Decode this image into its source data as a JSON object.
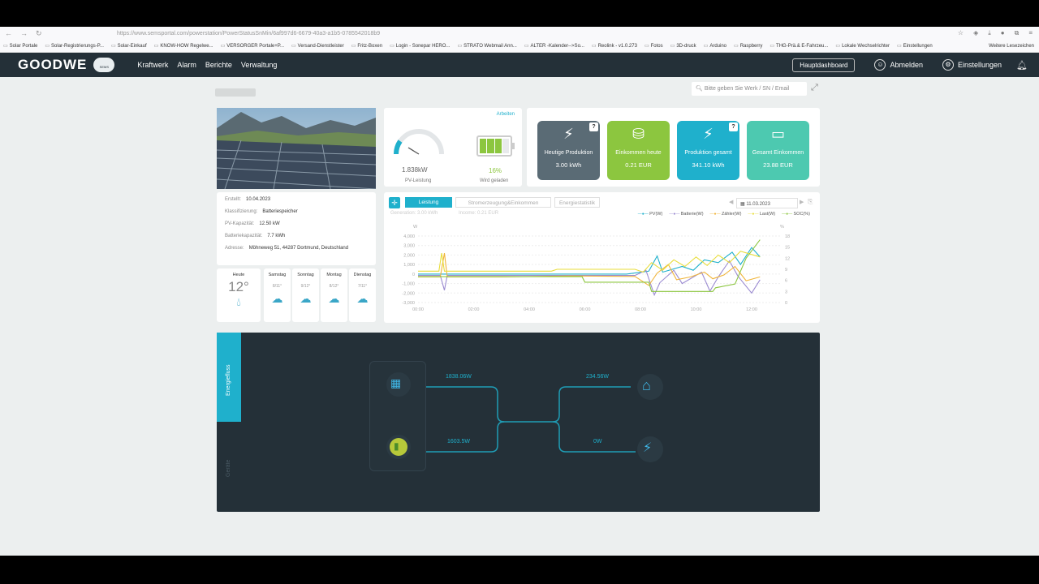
{
  "browser": {
    "url": "https://www.semsportal.com/powerstation/PowerStatusSnMin/6af997d6-6679-40a3-a1b5-0785542018b9",
    "bookmarks": [
      "Solar Portale",
      "Solar-Registrierungs-P...",
      "Solar-Einkauf",
      "KNOW-HOW Regelwe...",
      "VERSORGER Portale+P...",
      "Versand-Dienstleister",
      "Fritz-Boxen",
      "Login - Sonepar HERO...",
      "STRATO Webmail Ann...",
      "ALTER -Kalender-->So...",
      "Reolink - v1.0.273",
      "Fotos",
      "3D-druck",
      "Arduino",
      "Raspberry",
      "THG-Prä.& E-Fahrzeu...",
      "Lokale Wechselrichter",
      "Einstellungen"
    ],
    "more_bookmarks": "Weitere Lesezeichen"
  },
  "header": {
    "logo": "GOODWE",
    "logo_badge": "SEMS",
    "menu": [
      "Kraftwerk",
      "Alarm",
      "Berichte",
      "Verwaltung"
    ],
    "dashboard_button": "Hauptdashboard",
    "logout": "Abmelden",
    "settings": "Einstellungen"
  },
  "search": {
    "placeholder": "Bitte geben Sie Werk / SN / Email"
  },
  "info": {
    "rows": [
      {
        "label": "Erstellt:",
        "value": "10.04.2023"
      },
      {
        "label": "Klassifizierung:",
        "value": "Batteriespeicher"
      },
      {
        "label": "PV-Kapazität:",
        "value": "12.50 kW"
      },
      {
        "label": "Batteriekapazität:",
        "value": "7.7 kWh"
      },
      {
        "label": "Adresse:",
        "value": "Möhneweg 51, 44287 Dortmund, Deutschland"
      }
    ]
  },
  "weather": [
    {
      "day": "Heute",
      "temp": "12°",
      "icon": "rain-icon"
    },
    {
      "day": "Samstag",
      "temp": "8/11°",
      "icon": "cloud-sun-icon"
    },
    {
      "day": "Sonntag",
      "temp": "9/12°",
      "icon": "cloud-sun-icon"
    },
    {
      "day": "Montag",
      "temp": "8/12°",
      "icon": "cloud-sun-icon"
    },
    {
      "day": "Dienstag",
      "temp": "7/11°",
      "icon": "cloud-sun-icon"
    }
  ],
  "gauge": {
    "link": "Arbeiten",
    "pv_value": "1.838kW",
    "pv_label": "PV-Leistung",
    "battery_percent": "16%",
    "battery_label": "Wird geladen",
    "battery_level": 0.16
  },
  "stats": [
    {
      "label": "Heutige Produktion",
      "value": "3.00 kWh",
      "color": "#5a6b75",
      "help": true
    },
    {
      "label": "Einkommen heute",
      "value": "0.21 EUR",
      "color": "#8cc63f",
      "help": false
    },
    {
      "label": "Produktion gesamt",
      "value": "341.10 kWh",
      "color": "#1fb0cc",
      "help": true
    },
    {
      "label": "Gesamt Einkommen",
      "value": "23.88 EUR",
      "color": "#4dc9b0",
      "help": false
    }
  ],
  "chart_tabs": {
    "tabs": [
      "Leistung",
      "Stromerzeugung&Einkommen",
      "Energiestatistik"
    ],
    "date": "11.03.2023",
    "generation": "Generation: 3.00 kWh",
    "income": "Income: 0.21 EUR"
  },
  "chart_data": {
    "type": "line",
    "xlabel": "",
    "ylabel": "W",
    "y2label": "%",
    "x": [
      "00:00",
      "02:00",
      "04:00",
      "06:00",
      "08:00",
      "10:00",
      "12:00"
    ],
    "yticks": [
      "4,000",
      "3,000",
      "2,000",
      "1,000",
      "0",
      "-1,000",
      "-2,000",
      "-3,000"
    ],
    "y2ticks": [
      "18",
      "15",
      "12",
      "9",
      "6",
      "3",
      "0"
    ],
    "ylim": [
      -3000,
      4000
    ],
    "y2lim": [
      0,
      18
    ],
    "legend": [
      {
        "name": "PV(W)",
        "color": "#1fb0cc"
      },
      {
        "name": "Batterie(W)",
        "color": "#9b8bd1"
      },
      {
        "name": "Zähler(W)",
        "color": "#f0b43a"
      },
      {
        "name": "Last(W)",
        "color": "#e8dd3a"
      },
      {
        "name": "SOC(%)",
        "color": "#8cc63f"
      }
    ],
    "series": [
      {
        "name": "PV(W)",
        "points": [
          [
            0,
            0
          ],
          [
            7.5,
            0
          ],
          [
            8.3,
            300
          ],
          [
            8.6,
            1900
          ],
          [
            8.8,
            200
          ],
          [
            9.5,
            800
          ],
          [
            9.9,
            400
          ],
          [
            10.3,
            1500
          ],
          [
            10.8,
            1200
          ],
          [
            11.3,
            2300
          ],
          [
            11.6,
            1000
          ],
          [
            12,
            2800
          ],
          [
            12.3,
            1800
          ]
        ]
      },
      {
        "name": "Batterie(W)",
        "points": [
          [
            0,
            -150
          ],
          [
            0.8,
            -150
          ],
          [
            0.95,
            -1700
          ],
          [
            1.05,
            -150
          ],
          [
            7.8,
            -150
          ],
          [
            8.2,
            400
          ],
          [
            8.5,
            -2200
          ],
          [
            8.7,
            -900
          ],
          [
            9.2,
            400
          ],
          [
            9.5,
            -1000
          ],
          [
            10.2,
            200
          ],
          [
            10.5,
            -1800
          ],
          [
            10.8,
            -300
          ],
          [
            11.2,
            1400
          ],
          [
            11.5,
            -200
          ],
          [
            12,
            -2000
          ],
          [
            12.3,
            -600
          ]
        ]
      },
      {
        "name": "Zähler(W)",
        "points": [
          [
            0,
            -300
          ],
          [
            0.8,
            -300
          ],
          [
            0.95,
            2200
          ],
          [
            1.05,
            -300
          ],
          [
            3,
            -300
          ],
          [
            5.5,
            -200
          ],
          [
            7.8,
            -250
          ],
          [
            8.3,
            -1200
          ],
          [
            8.6,
            100
          ],
          [
            9,
            1000
          ],
          [
            9.3,
            -600
          ],
          [
            9.8,
            -300
          ],
          [
            10.3,
            200
          ],
          [
            10.6,
            -500
          ],
          [
            11,
            -100
          ],
          [
            11.4,
            800
          ],
          [
            11.8,
            -700
          ],
          [
            12.3,
            -300
          ]
        ]
      },
      {
        "name": "Last(W)",
        "points": [
          [
            0,
            300
          ],
          [
            0.75,
            300
          ],
          [
            0.85,
            2200
          ],
          [
            0.95,
            300
          ],
          [
            4.8,
            300
          ],
          [
            5,
            500
          ],
          [
            7.8,
            500
          ],
          [
            8.1,
            200
          ],
          [
            8.4,
            1200
          ],
          [
            8.8,
            400
          ],
          [
            9.2,
            1500
          ],
          [
            9.6,
            800
          ],
          [
            10,
            1800
          ],
          [
            10.4,
            900
          ],
          [
            10.8,
            2000
          ],
          [
            11.2,
            1200
          ],
          [
            11.6,
            2400
          ],
          [
            12.3,
            1800
          ]
        ]
      },
      {
        "name": "SOC(%)",
        "points": [
          [
            0,
            7
          ],
          [
            5.9,
            7
          ],
          [
            6,
            5.5
          ],
          [
            8.3,
            5.5
          ],
          [
            8.4,
            3
          ],
          [
            10.6,
            3
          ],
          [
            10.7,
            4
          ],
          [
            11.4,
            5
          ],
          [
            11.8,
            12
          ],
          [
            12.1,
            15
          ],
          [
            12.3,
            17
          ]
        ]
      }
    ]
  },
  "flow": {
    "tabs": [
      "Energiefluss",
      "Geräte"
    ],
    "pv_power": "1838.06W",
    "battery_power": "1603.5W",
    "load_power": "234.56W",
    "grid_power": "0W"
  }
}
